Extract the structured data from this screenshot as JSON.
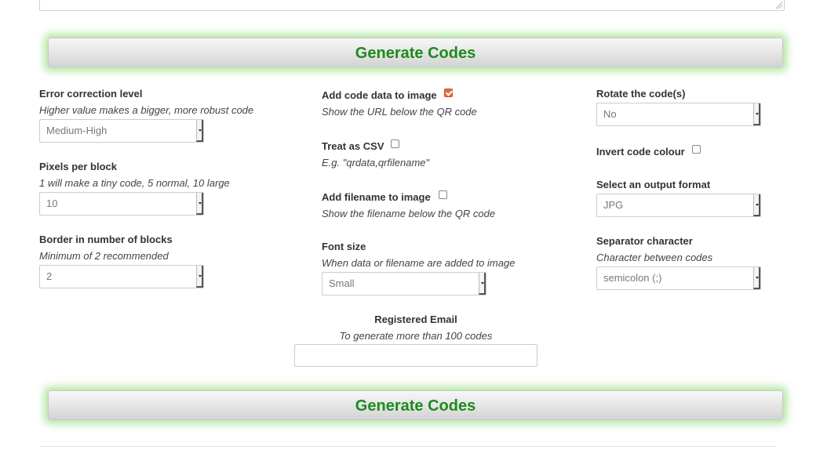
{
  "generate_button_label": "Generate Codes",
  "col1": {
    "error_correction": {
      "label": "Error correction level",
      "hint": "Higher value makes a bigger, more robust code",
      "value": "Medium-High"
    },
    "pixels_per_block": {
      "label": "Pixels per block",
      "hint": "1 will make a tiny code, 5 normal, 10 large",
      "value": "10"
    },
    "border_blocks": {
      "label": "Border in number of blocks",
      "hint": "Minimum of 2 recommended",
      "value": "2"
    }
  },
  "col2": {
    "add_code_data": {
      "label": "Add code data to image",
      "hint": "Show the URL below the QR code",
      "checked": true
    },
    "treat_csv": {
      "label": "Treat as CSV",
      "hint": "E.g. \"qrdata,qrfilename\"",
      "checked": false
    },
    "add_filename": {
      "label": "Add filename to image",
      "hint": "Show the filename below the QR code",
      "checked": false
    },
    "font_size": {
      "label": "Font size",
      "hint": "When data or filename are added to image",
      "value": "Small"
    }
  },
  "col3": {
    "rotate": {
      "label": "Rotate the code(s)",
      "value": "No"
    },
    "invert": {
      "label": "Invert code colour",
      "checked": false
    },
    "output_format": {
      "label": "Select an output format",
      "value": "JPG"
    },
    "separator": {
      "label": "Separator character",
      "hint": "Character between codes",
      "value": "semicolon (;)"
    }
  },
  "email": {
    "label": "Registered Email",
    "hint": "To generate more than 100 codes",
    "value": ""
  },
  "colors": {
    "accent_green": "#1d8b1d",
    "glow": "#78d25a",
    "checkbox_checked": "#e56d3e"
  }
}
